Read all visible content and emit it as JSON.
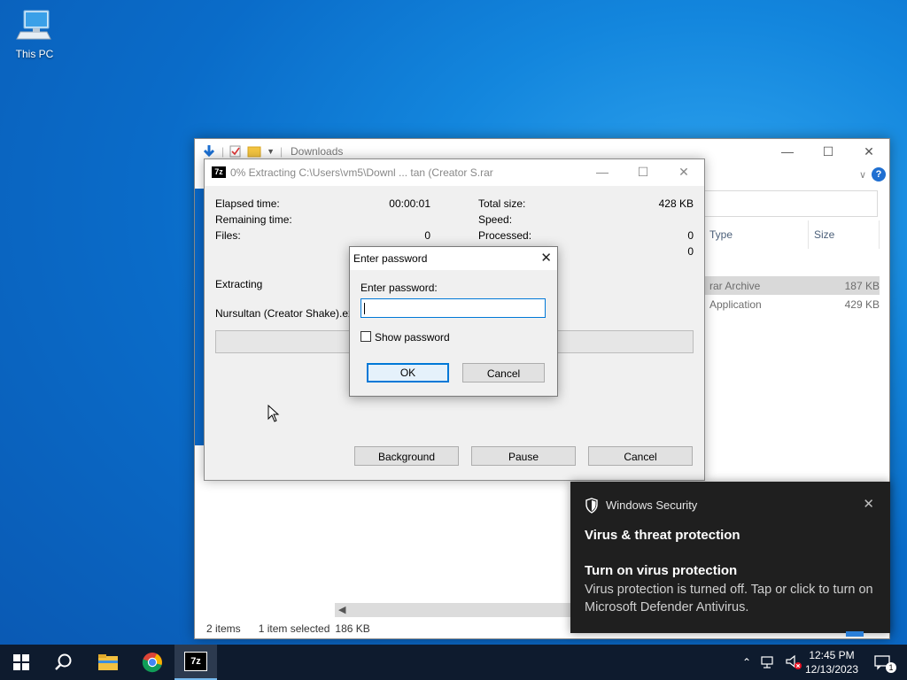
{
  "desktop": {
    "icon_label": "This PC"
  },
  "explorer": {
    "title": "Downloads",
    "columns": {
      "type": "Type",
      "size": "Size"
    },
    "rows": [
      {
        "type": "rar Archive",
        "size": "187 KB"
      },
      {
        "type": "Application",
        "size": "429 KB"
      }
    ],
    "status": {
      "items": "2 items",
      "selected": "1 item selected",
      "selected_size": "186 KB"
    }
  },
  "zip": {
    "title": "0% Extracting C:\\Users\\vm5\\Downl ... tan (Creator S.rar",
    "labels": {
      "elapsed": "Elapsed time:",
      "remaining": "Remaining time:",
      "files": "Files:",
      "total_size": "Total size:",
      "speed": "Speed:",
      "processed": "Processed:"
    },
    "values": {
      "elapsed": "00:00:01",
      "files": "0",
      "total_size": "428 KB",
      "processed": "0",
      "packed": "0"
    },
    "status": "Extracting",
    "current_file": "Nursultan (Creator Shake).exe",
    "progress": 0,
    "buttons": {
      "background": "Background",
      "pause": "Pause",
      "cancel": "Cancel"
    }
  },
  "password_dialog": {
    "title": "Enter password",
    "prompt": "Enter password:",
    "value": "",
    "show_password": "Show password",
    "ok": "OK",
    "cancel": "Cancel"
  },
  "toast": {
    "app": "Windows Security",
    "heading": "Virus & threat protection",
    "subheading": "Turn on virus protection",
    "body": "Virus protection is turned off. Tap or click to turn on Microsoft Defender Antivirus."
  },
  "taskbar": {
    "time": "12:45 PM",
    "date": "12/13/2023",
    "notification_count": "1",
    "pinned": [
      "start-icon",
      "search-icon",
      "file-explorer-icon",
      "chrome-icon",
      "7zip-icon"
    ]
  },
  "colors": {
    "accent": "#0078d7",
    "taskbar": "#0e1b2e",
    "toast_bg": "#1f1f1f"
  }
}
